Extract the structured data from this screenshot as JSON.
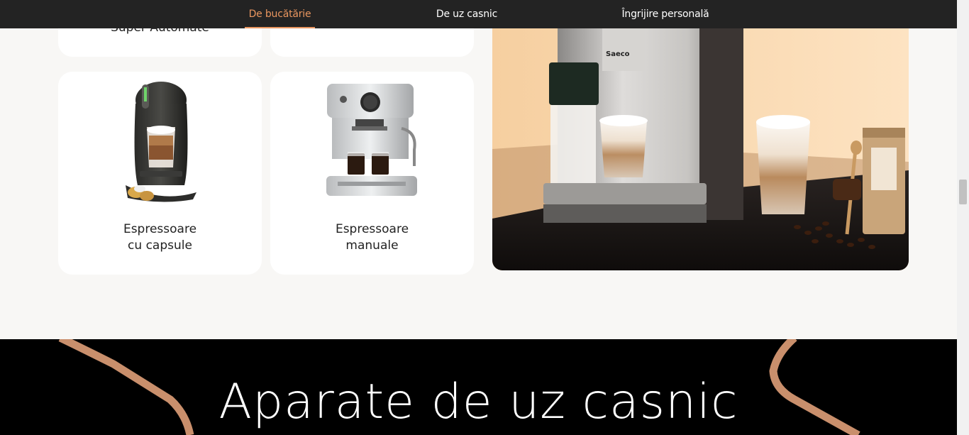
{
  "nav": {
    "tabs": [
      {
        "label": "De bucătărie",
        "active": true
      },
      {
        "label": "De uz casnic",
        "active": false
      },
      {
        "label": "Îngrijire personală",
        "active": false
      }
    ]
  },
  "categories": {
    "top_left_partial_label": "Super Automate",
    "bottom_row": [
      {
        "line1": "Espressoare",
        "line2": "cu capsule"
      },
      {
        "line1": "Espressoare",
        "line2": "manuale"
      }
    ]
  },
  "hero": {
    "brand": "Saeco"
  },
  "banner": {
    "title": "Aparate de uz casnic"
  },
  "colors": {
    "accent": "#e9965f",
    "nav_bg": "#232323",
    "banner_bg": "#000000",
    "banner_line": "#c98f6c",
    "hero_bg": "#fcdcb5"
  }
}
